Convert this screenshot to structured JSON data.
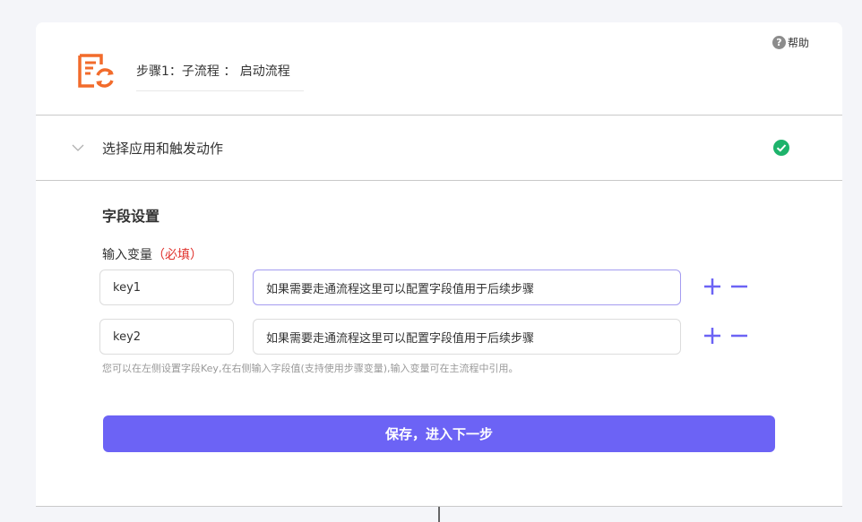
{
  "header": {
    "help_label": "帮助",
    "step_title": "步骤1：子流程 ： 启动流程"
  },
  "section": {
    "label": "选择应用和触发动作",
    "status_icon": "check-circle-icon",
    "status_color": "#1db36b"
  },
  "fields": {
    "title": "字段设置",
    "input_label": "输入变量",
    "required_label": "（必填）",
    "rows": [
      {
        "key": "key1",
        "value": "如果需要走通流程这里可以配置字段值用于后续步骤"
      },
      {
        "key": "key2",
        "value": "如果需要走通流程这里可以配置字段值用于后续步骤"
      }
    ],
    "hint": "您可以在左侧设置字段Key,在右侧输入字段值(支持使用步骤变量),输入变量可在主流程中引用。"
  },
  "actions": {
    "save_label": "保存，进入下一步"
  },
  "colors": {
    "accent": "#6c63f5",
    "logo": "#f26b2b",
    "required": "#e0302b"
  }
}
